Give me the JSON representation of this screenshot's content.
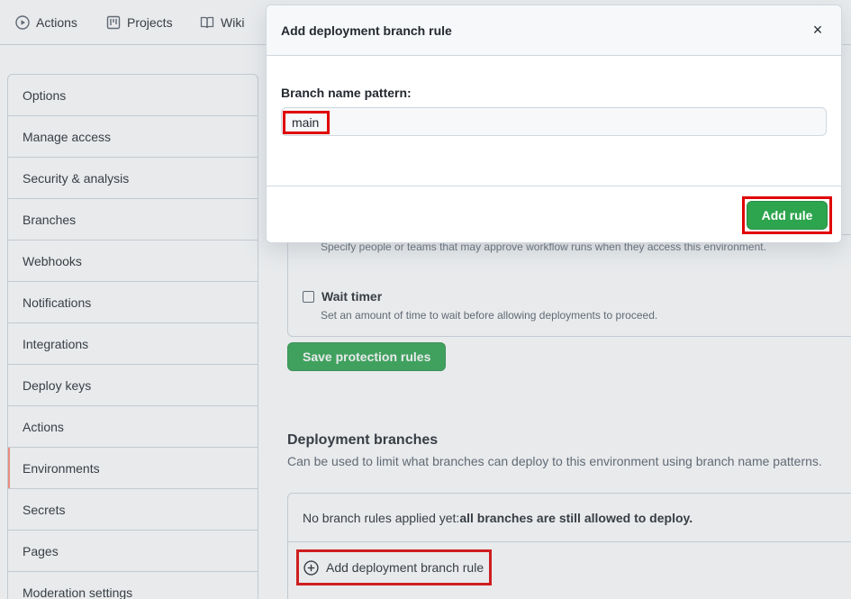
{
  "topnav": {
    "tabs": [
      {
        "label": "Actions",
        "icon": "play-icon"
      },
      {
        "label": "Projects",
        "icon": "project-icon"
      },
      {
        "label": "Wiki",
        "icon": "book-icon"
      }
    ]
  },
  "sidebar": {
    "items": [
      {
        "label": "Options"
      },
      {
        "label": "Manage access"
      },
      {
        "label": "Security & analysis"
      },
      {
        "label": "Branches"
      },
      {
        "label": "Webhooks"
      },
      {
        "label": "Notifications"
      },
      {
        "label": "Integrations"
      },
      {
        "label": "Deploy keys"
      },
      {
        "label": "Actions"
      },
      {
        "label": "Environments"
      },
      {
        "label": "Secrets"
      },
      {
        "label": "Pages"
      },
      {
        "label": "Moderation settings"
      }
    ]
  },
  "protection": {
    "reviewers_desc": "Specify people or teams that may approve workflow runs when they access this environment.",
    "wait_timer_label": "Wait timer",
    "wait_timer_desc": "Set an amount of time to wait before allowing deployments to proceed.",
    "save_button": "Save protection rules"
  },
  "deployment_branches": {
    "title": "Deployment branches",
    "description": "Can be used to limit what branches can deploy to this environment using branch name patterns.",
    "no_rules_prefix": "No branch rules applied yet: ",
    "no_rules_bold": "all branches are still allowed to deploy.",
    "add_rule_link": "Add deployment branch rule"
  },
  "modal": {
    "title": "Add deployment branch rule",
    "close": "×",
    "field_label": "Branch name pattern:",
    "field_value": "main",
    "submit": "Add rule"
  },
  "colors": {
    "primary_green": "#2da44e",
    "highlight_red": "#e00000",
    "selected_accent": "#fd8c73"
  }
}
